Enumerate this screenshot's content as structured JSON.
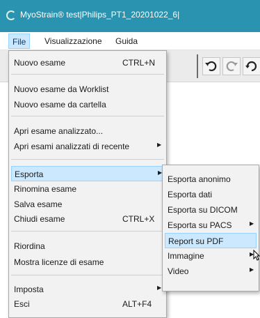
{
  "window": {
    "title": "MyoStrain® test|Philips_PT1_20201022_6|",
    "logo_icon": "app-logo-icon"
  },
  "menubar": {
    "items": [
      "File",
      "Visualizzazione",
      "Guida"
    ],
    "active": "File"
  },
  "toolbar": {
    "buttons": [
      "undo-icon",
      "redo-icon",
      "rotate-icon"
    ]
  },
  "file_menu": {
    "items": [
      {
        "label": "Nuovo esame",
        "shortcut": "CTRL+N"
      },
      {
        "label": "Nuovo esame da Worklist"
      },
      {
        "label": "Nuovo esame da cartella"
      },
      {
        "label": "Apri esame analizzato..."
      },
      {
        "label": "Apri esami analizzati di recente",
        "submenu": true
      },
      {
        "label": "Esporta",
        "submenu": true,
        "highlighted": true
      },
      {
        "label": "Rinomina esame"
      },
      {
        "label": "Salva esame"
      },
      {
        "label": "Chiudi esame",
        "shortcut": "CTRL+X"
      },
      {
        "label": "Riordina"
      },
      {
        "label": "Mostra licenze di esame"
      },
      {
        "label": "Imposta",
        "submenu": true
      },
      {
        "label": "Esci",
        "shortcut": "ALT+F4"
      }
    ]
  },
  "export_menu": {
    "items": [
      {
        "label": "Esporta anonimo"
      },
      {
        "label": "Esporta dati"
      },
      {
        "label": "Esporta su DICOM"
      },
      {
        "label": "Esporta su PACS",
        "submenu": true
      },
      {
        "label": "Report su PDF",
        "highlighted": true
      },
      {
        "label": "Immagine",
        "submenu": true
      },
      {
        "label": "Video",
        "submenu": true
      }
    ]
  },
  "arrow_glyph": "▶",
  "colors": {
    "titlebar": "#2a93b0",
    "highlight": "#cce8ff",
    "highlight_border": "#99d1ff",
    "menu_bg": "#f2f2f2"
  }
}
